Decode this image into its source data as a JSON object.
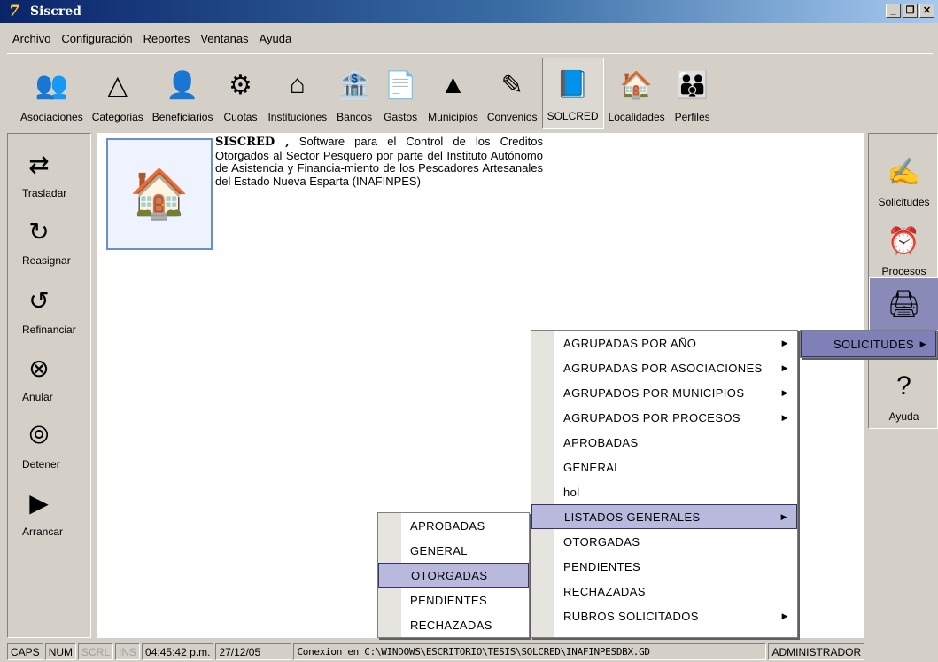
{
  "window": {
    "title": "Siscred",
    "app_icon": "app-icon"
  },
  "menubar": [
    "Archivo",
    "Configuración",
    "Reportes",
    "Ventanas",
    "Ayuda"
  ],
  "toolbar": [
    {
      "label": "Asociaciones",
      "icon": "people-icon"
    },
    {
      "label": "Categorias",
      "icon": "shapes-icon"
    },
    {
      "label": "Beneficiarios",
      "icon": "person-icon"
    },
    {
      "label": "Cuotas",
      "icon": "wrench-icon"
    },
    {
      "label": "Instituciones",
      "icon": "house-icon"
    },
    {
      "label": "Bancos",
      "icon": "bank-icon"
    },
    {
      "label": "Gastos",
      "icon": "document-icon"
    },
    {
      "label": "Municipios",
      "icon": "map-icon"
    },
    {
      "label": "Convenios",
      "icon": "edit-icon"
    },
    {
      "label": "SOLCRED",
      "icon": "book-check-icon",
      "active": true
    },
    {
      "label": "Localidades",
      "icon": "village-icon"
    },
    {
      "label": "Perfiles",
      "icon": "group-icon"
    }
  ],
  "leftbar": [
    {
      "label": "Trasladar",
      "icon": "transfer-icon"
    },
    {
      "label": "Reasignar",
      "icon": "reassign-icon"
    },
    {
      "label": "Refinanciar",
      "icon": "refinance-icon"
    },
    {
      "label": "Anular",
      "icon": "cancel-icon"
    },
    {
      "label": "Detener",
      "icon": "stop-icon"
    },
    {
      "label": "Arrancar",
      "icon": "start-icon"
    }
  ],
  "rightbar": [
    {
      "label": "Solicitudes",
      "icon": "pen-icon"
    },
    {
      "label": "Procesos",
      "icon": "clock-icon"
    },
    {
      "label": "",
      "icon": "printer-icon",
      "active": true
    },
    {
      "label": "Ayuda",
      "icon": "help-icon"
    }
  ],
  "intro": {
    "bold": "SISCRED ,",
    "text": " Software para el Control de los Creditos Otorgados al Sector Pesquero por parte del Instituto Autónomo de Asistencia y Financia-miento de los Pescadores Artesanales del Estado Nueva Esparta (INAFINPES)"
  },
  "menu_level1": {
    "label": "SOLICITUDES"
  },
  "menu_level2": [
    {
      "label": "AGRUPADAS POR AÑO",
      "submenu": true
    },
    {
      "label": "AGRUPADAS POR ASOCIACIONES",
      "submenu": true
    },
    {
      "label": "AGRUPADOS POR MUNICIPIOS",
      "submenu": true
    },
    {
      "label": "AGRUPADOS POR PROCESOS",
      "submenu": true
    },
    {
      "label": "APROBADAS",
      "submenu": false
    },
    {
      "label": "GENERAL",
      "submenu": false
    },
    {
      "label": "hol",
      "submenu": false
    },
    {
      "label": "LISTADOS GENERALES",
      "submenu": true,
      "highlighted": true
    },
    {
      "label": "OTORGADAS",
      "submenu": false
    },
    {
      "label": "PENDIENTES",
      "submenu": false
    },
    {
      "label": "RECHAZADAS",
      "submenu": false
    },
    {
      "label": "RUBROS SOLICITADOS",
      "submenu": true
    }
  ],
  "menu_level3": [
    {
      "label": "APROBADAS"
    },
    {
      "label": "GENERAL"
    },
    {
      "label": "OTORGADAS",
      "highlighted": true
    },
    {
      "label": "PENDIENTES"
    },
    {
      "label": "RECHAZADAS"
    }
  ],
  "statusbar": {
    "caps": "CAPS",
    "num": "NUM",
    "scrl": "SCRL",
    "ins": "INS",
    "time": "04:45:42 p.m.",
    "date": "27/12/05",
    "connection": "Conexion en C:\\WINDOWS\\ESCRITORIO\\TESIS\\SOLCRED\\INAFINPESDBX.GD",
    "user": "ADMINISTRADOR"
  },
  "colors": {
    "title_start": "#0a246a",
    "title_end": "#a6caf0",
    "menu_highlight": "#b9b9de",
    "panel": "#d4d0c8"
  }
}
